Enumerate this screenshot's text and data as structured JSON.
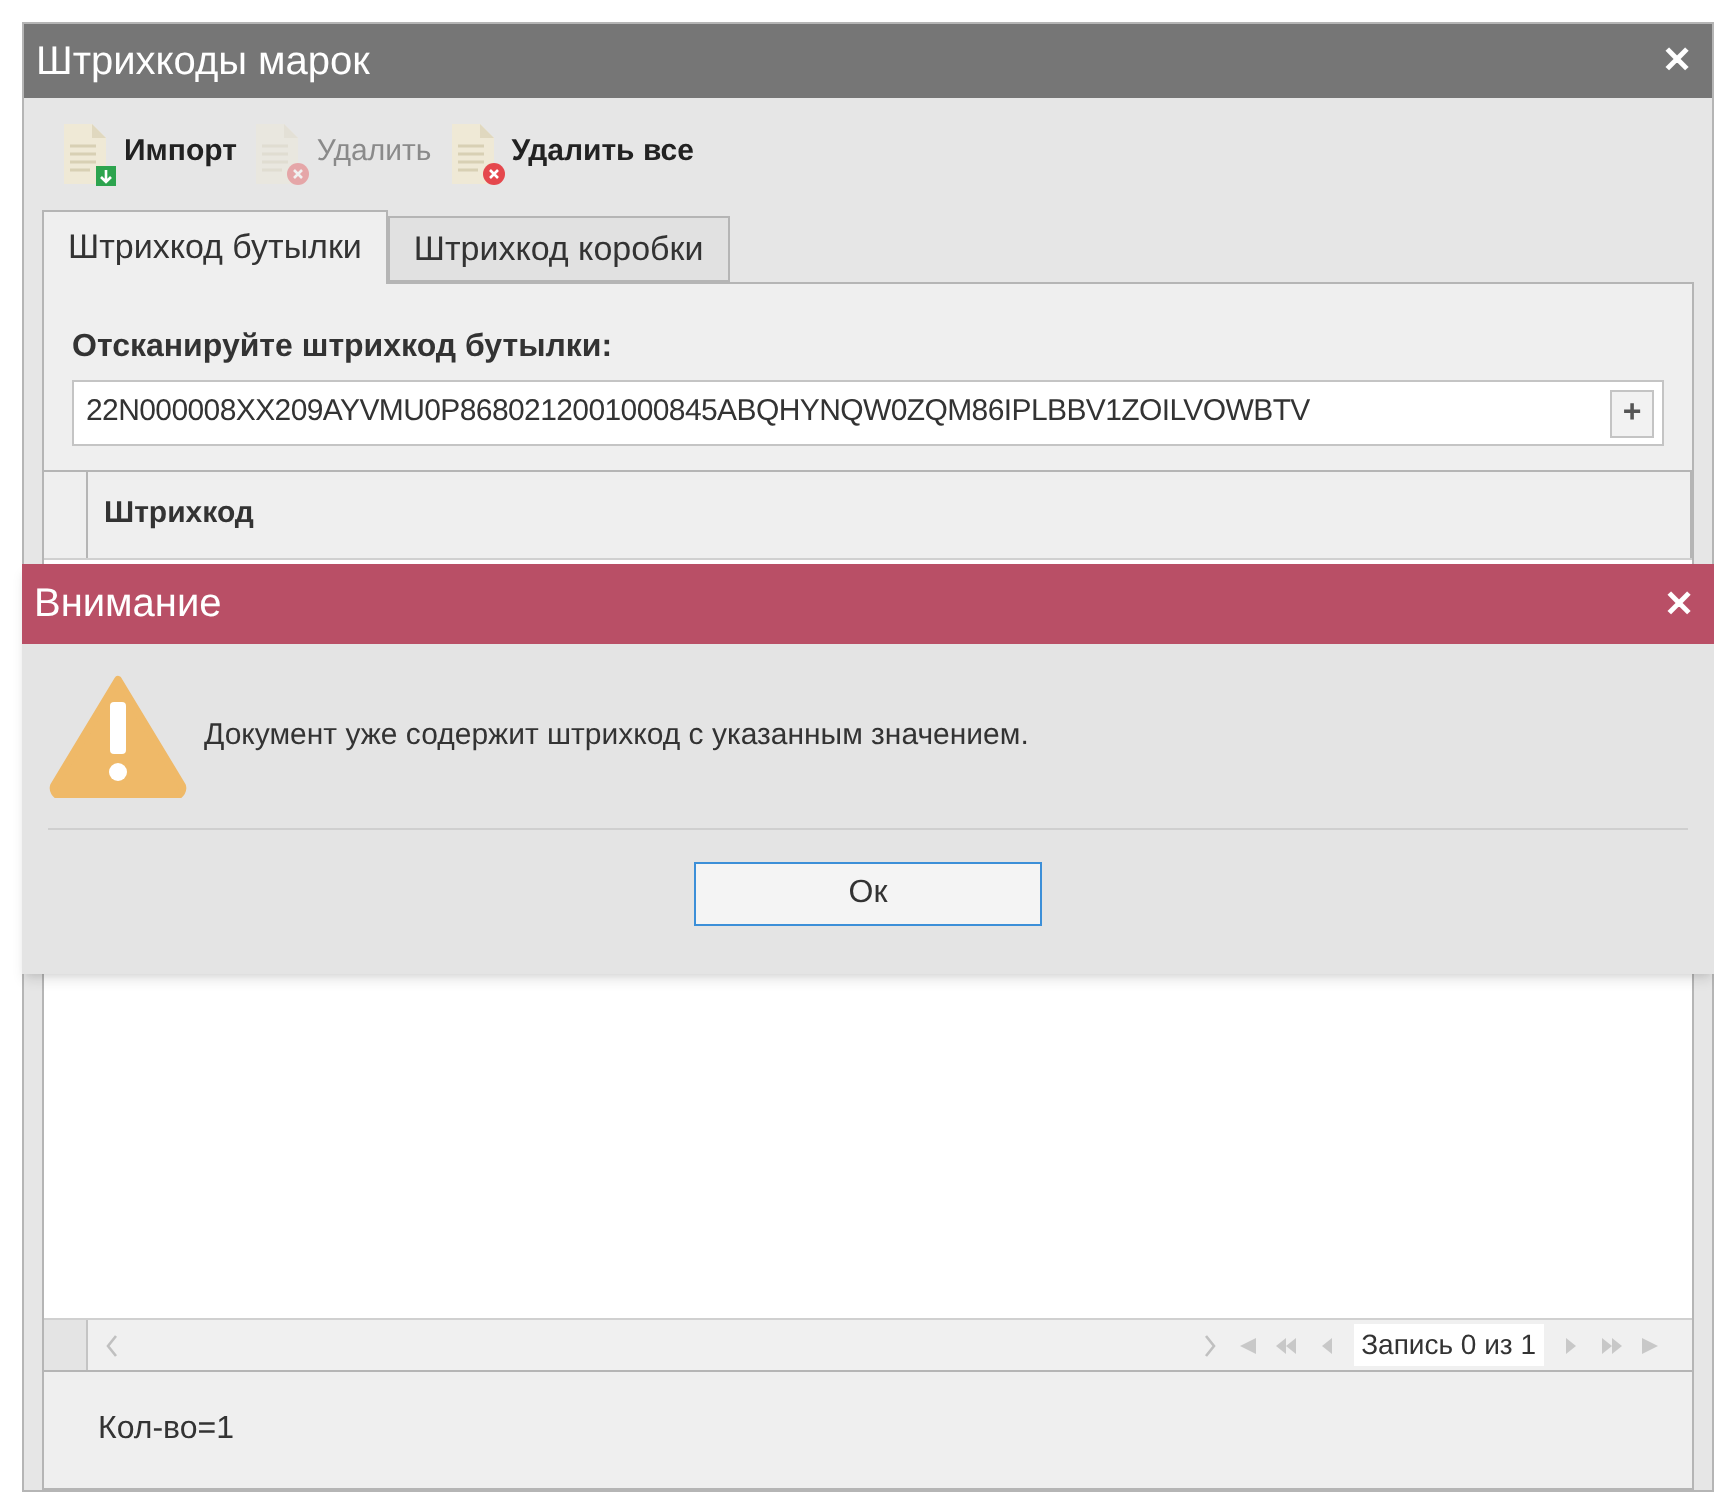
{
  "window": {
    "title": "Штрихкоды марок",
    "close": "✕"
  },
  "toolbar": [
    {
      "kind": "import",
      "label": "Импорт",
      "disabled": false
    },
    {
      "kind": "delete",
      "label": "Удалить",
      "disabled": true
    },
    {
      "kind": "delete",
      "label": "Удалить все",
      "disabled": false
    }
  ],
  "tabs": [
    {
      "label": "Штрихкод бутылки",
      "selected": true
    },
    {
      "label": "Штрихкод коробки",
      "selected": false
    }
  ],
  "scan": {
    "label": "Отсканируйте штрихкод бутылки:",
    "value": "22N000008XX209AYVMU0P868021200100084​5ABQHYNQW0ZQM86IPLBBV1ZOILVOWBTV",
    "add": "+"
  },
  "table": {
    "columns": [
      "Штрихкод"
    ]
  },
  "pager": {
    "text": "Запись 0 из 1"
  },
  "footer": {
    "count": "Кол-во=1"
  },
  "dialog": {
    "title": "Внимание",
    "close": "✕",
    "message": "Документ уже содержит штрихкод с указанным значением.",
    "button": "Ок"
  }
}
